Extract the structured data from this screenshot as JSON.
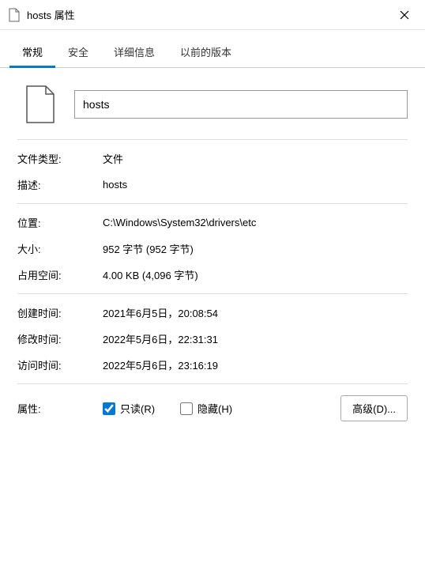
{
  "titlebar": {
    "title": "hosts 属性"
  },
  "tabs": {
    "general": "常规",
    "security": "安全",
    "details": "详细信息",
    "previous": "以前的版本"
  },
  "filename": "hosts",
  "labels": {
    "filetype": "文件类型:",
    "description": "描述:",
    "location": "位置:",
    "size": "大小:",
    "size_on_disk": "占用空间:",
    "created": "创建时间:",
    "modified": "修改时间:",
    "accessed": "访问时间:",
    "attributes": "属性:"
  },
  "values": {
    "filetype": "文件",
    "description": "hosts",
    "location": "C:\\Windows\\System32\\drivers\\etc",
    "size": "952 字节 (952 字节)",
    "size_on_disk": "4.00 KB (4,096 字节)",
    "created": "2021年6月5日，20:08:54",
    "modified": "2022年5月6日，22:31:31",
    "accessed": "2022年5月6日，23:16:19"
  },
  "attributes": {
    "readonly_label": "只读(R)",
    "readonly_checked": true,
    "hidden_label": "隐藏(H)",
    "hidden_checked": false,
    "advanced_button": "高级(D)..."
  }
}
